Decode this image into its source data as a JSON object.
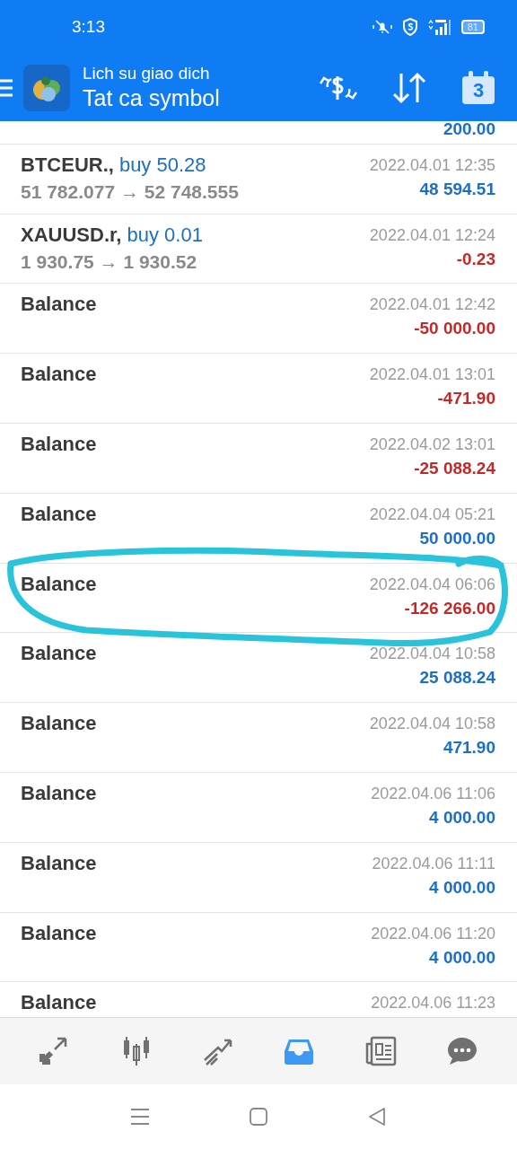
{
  "status_bar": {
    "time": "3:13",
    "battery": "81"
  },
  "header": {
    "title": "Lich su giao dich",
    "subtitle": "Tat ca symbol",
    "calendar_day": "3"
  },
  "deals": [
    {
      "kind": "partial",
      "amount": "200.00",
      "color": "#1a6fc9"
    },
    {
      "kind": "trade",
      "symbol": "BTCEUR.,",
      "side": "buy 50.28",
      "prices": "51 782.077 → 52 748.555",
      "time": "2022.04.01 12:35",
      "amount": "48 594.51",
      "color": "#1a6fc9"
    },
    {
      "kind": "trade",
      "symbol": "XAUUSD.r,",
      "side": "buy 0.01",
      "prices": "1 930.75 → 1 930.52",
      "time": "2022.04.01 12:24",
      "amount": "-0.23",
      "color": "#c62828"
    },
    {
      "kind": "balance",
      "symbol": "Balance",
      "time": "2022.04.01 12:42",
      "amount": "-50 000.00",
      "color": "#c62828"
    },
    {
      "kind": "balance",
      "symbol": "Balance",
      "time": "2022.04.01 13:01",
      "amount": "-471.90",
      "color": "#c62828"
    },
    {
      "kind": "balance",
      "symbol": "Balance",
      "time": "2022.04.02 13:01",
      "amount": "-25 088.24",
      "color": "#c62828"
    },
    {
      "kind": "balance",
      "symbol": "Balance",
      "time": "2022.04.04 05:21",
      "amount": "50 000.00",
      "color": "#1a6fc9"
    },
    {
      "kind": "balance",
      "symbol": "Balance",
      "time": "2022.04.04 06:06",
      "amount": "-126 266.00",
      "color": "#c62828"
    },
    {
      "kind": "balance",
      "symbol": "Balance",
      "time": "2022.04.04 10:58",
      "amount": "25 088.24",
      "color": "#1a6fc9"
    },
    {
      "kind": "balance",
      "symbol": "Balance",
      "time": "2022.04.04 10:58",
      "amount": "471.90",
      "color": "#1a6fc9"
    },
    {
      "kind": "balance",
      "symbol": "Balance",
      "time": "2022.04.06 11:06",
      "amount": "4 000.00",
      "color": "#1a6fc9"
    },
    {
      "kind": "balance",
      "symbol": "Balance",
      "time": "2022.04.06 11:11",
      "amount": "4 000.00",
      "color": "#1a6fc9"
    },
    {
      "kind": "balance",
      "symbol": "Balance",
      "time": "2022.04.06 11:20",
      "amount": "4 000.00",
      "color": "#1a6fc9"
    },
    {
      "kind": "balance",
      "symbol": "Balance",
      "time": "2022.04.06 11:23"
    }
  ],
  "bottom_nav": [
    {
      "kind": "quotes",
      "selected": false
    },
    {
      "kind": "chart",
      "selected": false
    },
    {
      "kind": "trade",
      "selected": false
    },
    {
      "kind": "history",
      "selected": true
    },
    {
      "kind": "news",
      "selected": false
    },
    {
      "kind": "chat",
      "selected": false
    }
  ]
}
